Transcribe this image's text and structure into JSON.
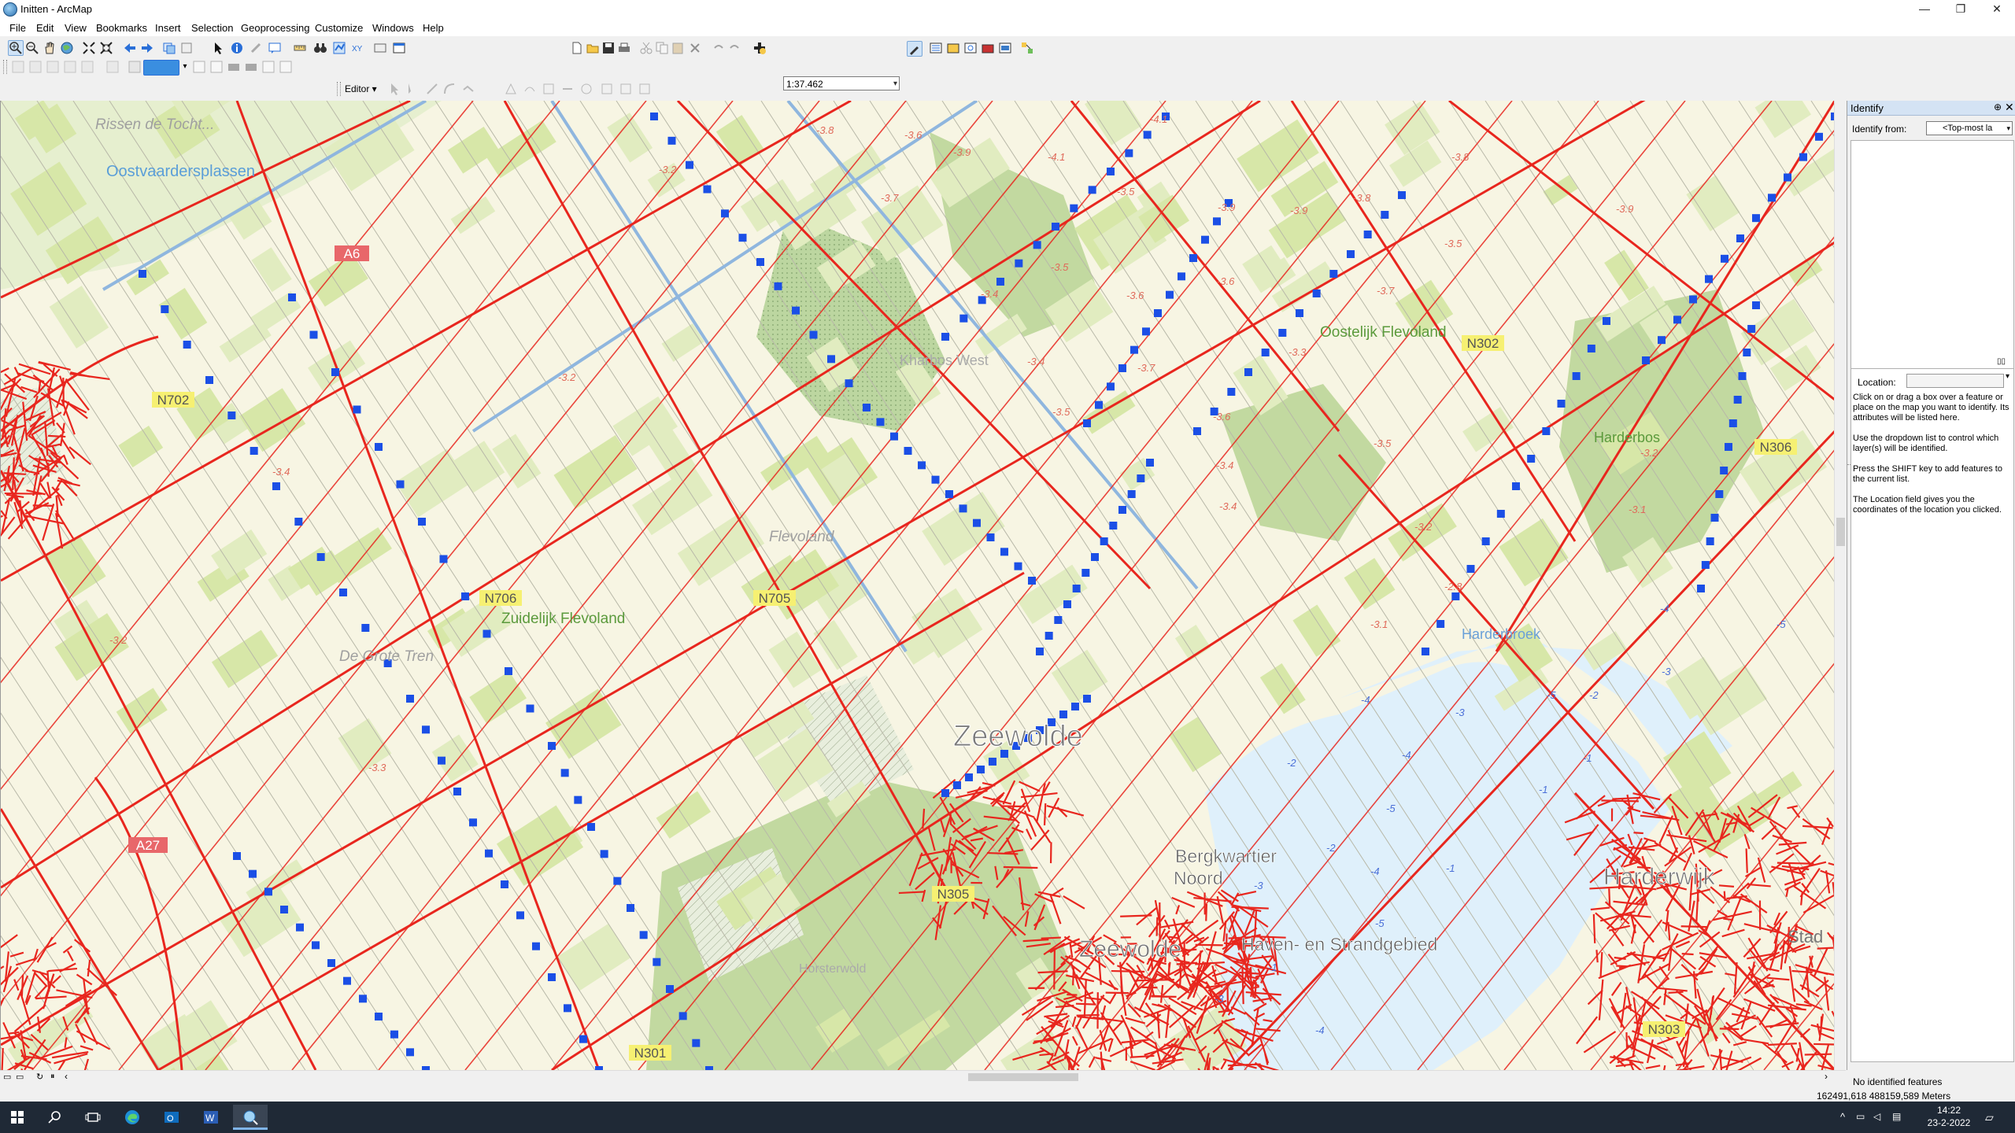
{
  "window": {
    "title": "Initten - ArcMap",
    "minimize": "—",
    "maximize": "❐",
    "close": "✕"
  },
  "menu": [
    "File",
    "Edit",
    "View",
    "Bookmarks",
    "Insert",
    "Selection",
    "Geoprocessing",
    "Customize",
    "Windows",
    "Help"
  ],
  "toolbar": {
    "scale": "1:37.462",
    "editor_label": "Editor ▾"
  },
  "map": {
    "place_labels": {
      "zeewolde": "Zeewolde",
      "flevoland": "Flevoland",
      "zuidelijk_flevoland": "Zuidelijk Flevoland",
      "de_grote_tren": "De Grote Tren",
      "oostvaardersplassen": "Oostvaardersplassen",
      "rissen": "Rissen de Tocht...",
      "oostelijk_flevoland": "Oostelijk Flevoland",
      "harderbos": "Harderbos",
      "harderbroek": "Harderbroek",
      "bergkwartier": "Bergkwartier",
      "noord": "Noord",
      "haven": "Haven- en Strandgebied",
      "zeewolde_south": "Zeewolde",
      "kharbos": "Kharbos West",
      "horsterwold": "Horsterwold",
      "harderwijk": "Harderwijk",
      "stad": "Stad"
    },
    "road_labels": {
      "a6": "A6",
      "a27": "A27",
      "n702": "N702",
      "n706": "N706",
      "n705": "N705",
      "n305": "N305",
      "n301": "N301",
      "n302": "N302",
      "n306": "N306",
      "n303": "N303"
    },
    "elevations_land": [
      "-3.8",
      "-3.6",
      "-4.1",
      "-3.9",
      "-4.1",
      "-3.2",
      "-3.7",
      "-3.5",
      "-3.5",
      "-3.6",
      "-3.4",
      "-3.2",
      "-3.4",
      "-3.4",
      "-3.2",
      "-3.3",
      "-3.9",
      "-3.9",
      "-3.6",
      "-3.7",
      "-3.5",
      "-3.3",
      "-3.4",
      "-3.8",
      "-3.6",
      "-3.7",
      "-3.5",
      "-3.4",
      "-3.2",
      "-3.8",
      "-3.9",
      "-3.5",
      "-3.1",
      "-3.2",
      "-2.8",
      "-3.1"
    ],
    "depths_water": [
      "-4",
      "-5",
      "-3",
      "-2",
      "-4",
      "-3",
      "-5",
      "-2",
      "-1",
      "-5",
      "-4",
      "-2",
      "-1",
      "-1",
      "-3",
      "-4",
      "-1",
      "-5",
      "-4",
      "-3"
    ]
  },
  "identify": {
    "title": "Identify",
    "pin": "⊕",
    "close": "✕",
    "from_label": "Identify from:",
    "from_value": "<Top-most la",
    "location_label": "Location:",
    "location_value": "",
    "help": [
      "Click on or drag a box over a feature or place on the map you want to identify. Its attributes will be listed here.",
      "Use the dropdown list to control which layer(s) will be identified.",
      "Press the SHIFT key to add features to the current list.",
      "The Location field gives you the coordinates of the location you clicked."
    ],
    "status": "No identified features"
  },
  "status": {
    "coordinates": "162491,618  488159,589 Meters"
  },
  "taskbar": {
    "time": "14:22",
    "date": "23-2-2022"
  },
  "colors": {
    "road": "#e8261e",
    "blue_point": "#1b4fe6",
    "water": "#dff0fb",
    "field_green": "#d7e7a8",
    "forest": "#c2d9a0",
    "canal": "#8fb6de"
  }
}
